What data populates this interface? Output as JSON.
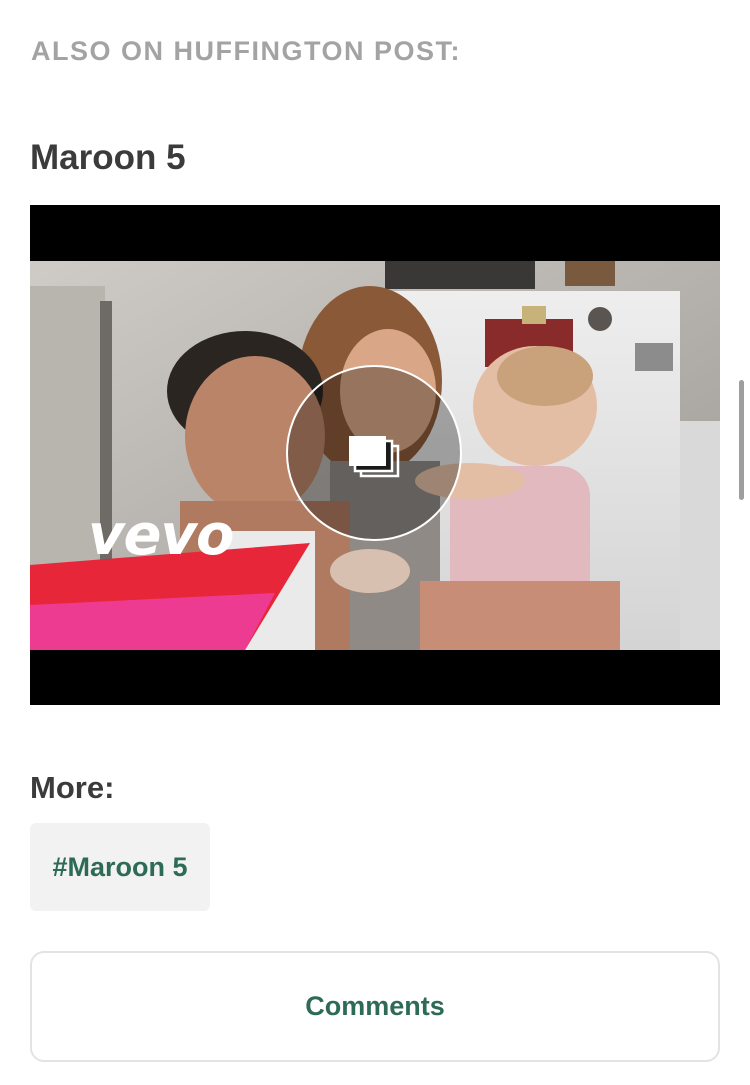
{
  "section": {
    "also_on": "ALSO ON HUFFINGTON POST:"
  },
  "slideshow": {
    "title": "Maroon 5",
    "overlay_brand": "vevo",
    "overlay_icon": "gallery-icon",
    "brand_colors": {
      "vevo_red": "#e8263a",
      "vevo_pink": "#ee3e9c"
    }
  },
  "more": {
    "label": "More:",
    "tags": [
      "#Maroon 5"
    ]
  },
  "comments": {
    "label": "Comments"
  },
  "colors": {
    "accent": "#2e6b57",
    "heading": "#3b3b3b",
    "muted": "#a3a3a3",
    "chip_bg": "#f2f2f2"
  }
}
